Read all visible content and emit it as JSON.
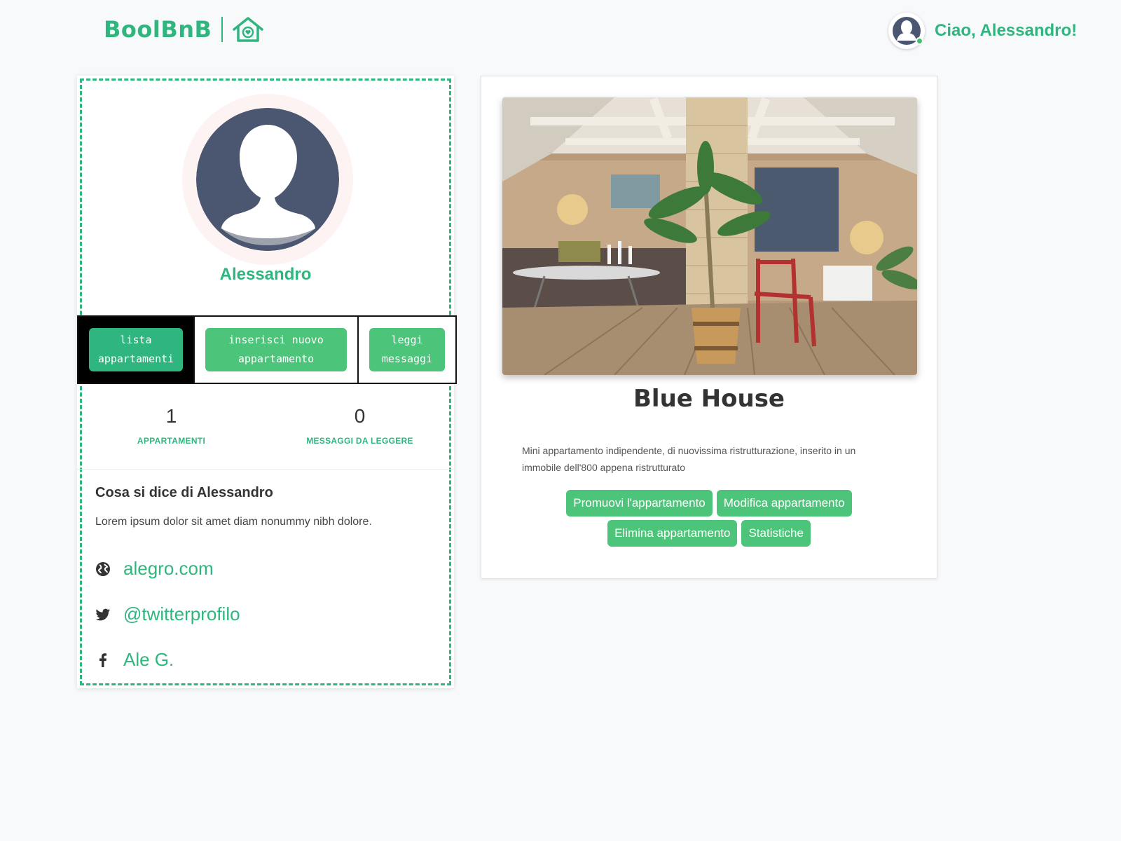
{
  "header": {
    "logo_text": "BoolBnB",
    "logo_icon": "house-heart-icon",
    "greeting": "Ciao, Alessandro!"
  },
  "profile": {
    "name": "Alessandro",
    "tabs": [
      {
        "label": "lista appartamenti",
        "active": true
      },
      {
        "label": "inserisci nuovo appartamento",
        "active": false
      },
      {
        "label": "leggi messaggi",
        "active": false
      }
    ],
    "stats": [
      {
        "value": "1",
        "label": "APPARTAMENTI"
      },
      {
        "value": "0",
        "label": "MESSAGGI DA LEGGERE"
      }
    ],
    "about_title": "Cosa si dice di Alessandro",
    "about_text": "Lorem ipsum dolor sit amet diam nonummy nibh dolore.",
    "links": [
      {
        "icon": "globe-icon",
        "text": "alegro.com"
      },
      {
        "icon": "twitter-icon",
        "text": "@twitterprofilo"
      },
      {
        "icon": "facebook-icon",
        "text": "Ale G."
      }
    ]
  },
  "apartment": {
    "title": "Blue House",
    "description": "Mini appartamento indipendente, di nuovissima ristrutturazione, inserito in un immobile dell'800 appena ristrutturato",
    "buttons": [
      "Promuovi l'appartamento",
      "Modifica appartamento",
      "Elimina appartamento",
      "Statistiche"
    ]
  },
  "colors": {
    "brand": "#2fb67f",
    "button": "#4cc47a",
    "online": "#3fc06d"
  }
}
